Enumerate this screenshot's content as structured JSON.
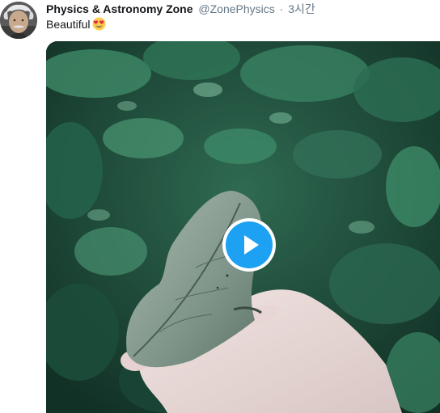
{
  "tweet": {
    "display_name": "Physics & Astronomy Zone",
    "handle": "@ZonePhysics",
    "separator": "·",
    "timestamp": "3시간",
    "text": "Beautiful",
    "emoji": "heart-eyes-emoji"
  },
  "media": {
    "type": "video",
    "play_icon": "play-icon",
    "accent_color": "#1da1f2"
  },
  "colors": {
    "name": "#14171a",
    "secondary": "#657786"
  }
}
